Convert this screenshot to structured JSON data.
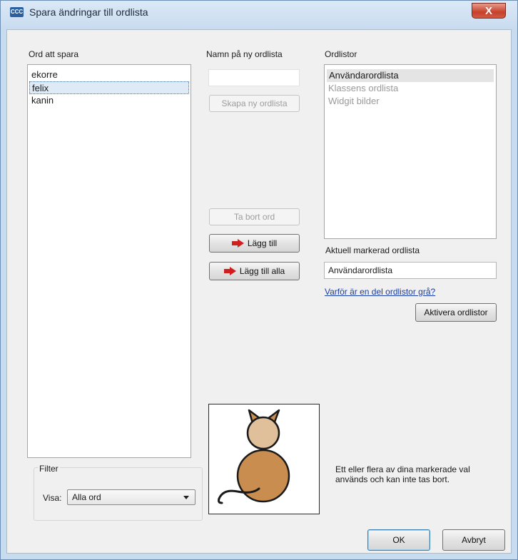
{
  "window": {
    "title": "Spara ändringar till ordlista",
    "app_icon_text": "CCC",
    "close_symbol": "X"
  },
  "words": {
    "label": "Ord att spara",
    "items": [
      "ekorre",
      "felix",
      "kanin"
    ],
    "selected": "felix"
  },
  "new_list": {
    "label": "Namn på ny ordlista",
    "value": "",
    "create_button": "Skapa ny ordlista"
  },
  "actions": {
    "remove_word": "Ta bort ord",
    "add": "Lägg till",
    "add_all": "Lägg till alla"
  },
  "wordlists": {
    "label": "Ordlistor",
    "items": [
      {
        "name": "Användarordlista",
        "state": "current"
      },
      {
        "name": "Klassens ordlista",
        "state": "disabled"
      },
      {
        "name": "Widgit bilder",
        "state": "disabled"
      }
    ]
  },
  "current_list": {
    "label": "Aktuell markerad ordlista",
    "value": "Användarordlista"
  },
  "help_link": "Varför är en del ordlistor grå?",
  "activate_button": "Aktivera ordlistor",
  "filter": {
    "group_label": "Filter",
    "show_label": "Visa:",
    "selected_option": "Alla ord"
  },
  "info_text_line1": "Ett eller flera av dina markerade val",
  "info_text_line2": "används och kan inte tas bort.",
  "footer": {
    "ok": "OK",
    "cancel": "Avbryt"
  },
  "colors": {
    "arrow": "#d21e1e",
    "cat_body": "#c98d4f",
    "cat_head": "#e0c09a",
    "link": "#1a3da8"
  },
  "icons": [
    "app-icon",
    "close-icon",
    "red-arrow-icon",
    "chevron-down-icon",
    "cat-symbol-image"
  ]
}
